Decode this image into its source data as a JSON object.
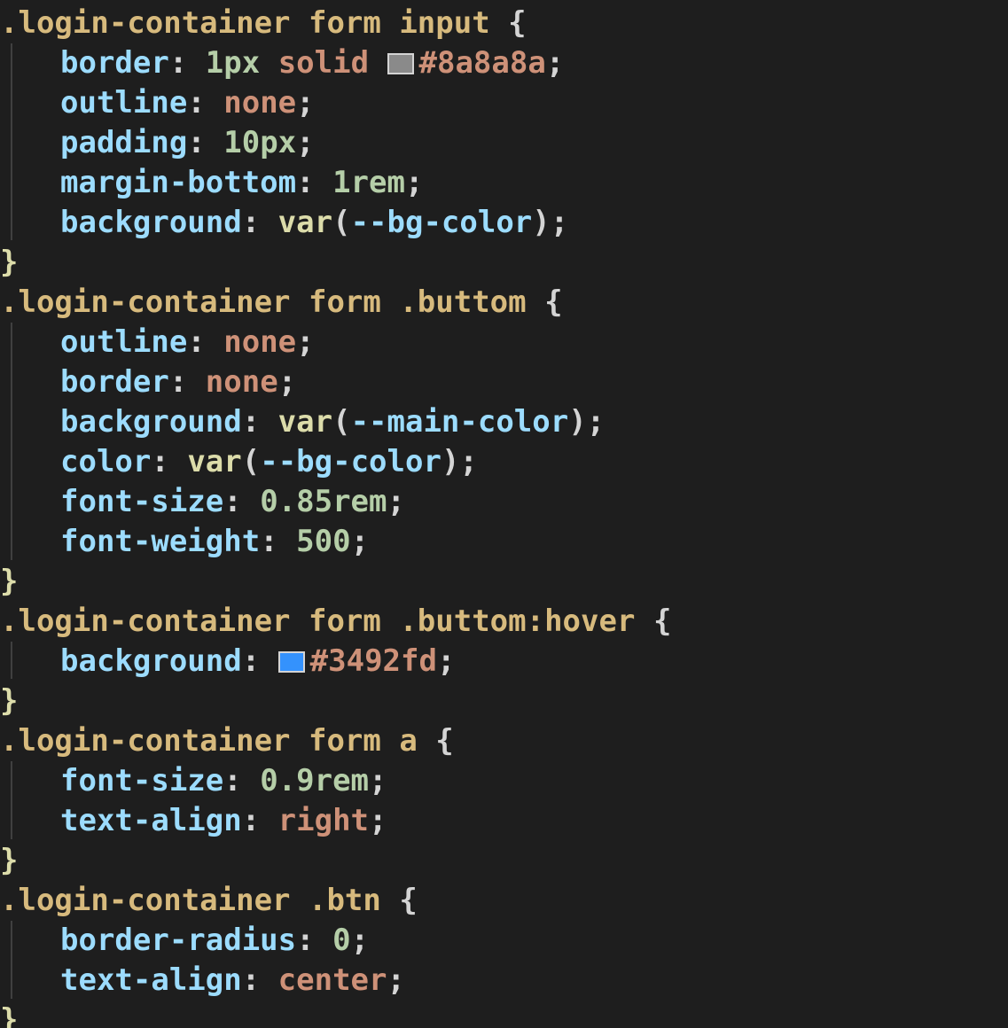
{
  "editor": {
    "blocks": [
      {
        "selector": ".login-container form input",
        "lines": [
          {
            "prop": "border",
            "value_parts": [
              "1px",
              " solid "
            ],
            "swatch": "#8a8a8a",
            "color_text": "#8a8a8a"
          },
          {
            "prop": "outline",
            "value": "none"
          },
          {
            "prop": "padding",
            "value": "10px"
          },
          {
            "prop": "margin-bottom",
            "value": "1rem"
          },
          {
            "prop": "background",
            "func": "var",
            "arg": "--bg-color"
          }
        ]
      },
      {
        "selector": ".login-container form .buttom",
        "lines": [
          {
            "prop": "outline",
            "value": "none"
          },
          {
            "prop": "border",
            "value": "none"
          },
          {
            "prop": "background",
            "func": "var",
            "arg": "--main-color"
          },
          {
            "prop": "color",
            "func": "var",
            "arg": "--bg-color"
          },
          {
            "prop": "font-size",
            "value": "0.85rem"
          },
          {
            "prop": "font-weight",
            "value": "500"
          }
        ]
      },
      {
        "selector": ".login-container form .buttom:hover",
        "lines": [
          {
            "prop": "background",
            "swatch": "#3492fd",
            "color_text": "#3492fd"
          }
        ]
      },
      {
        "selector": ".login-container form a",
        "lines": [
          {
            "prop": "font-size",
            "value": "0.9rem"
          },
          {
            "prop": "text-align",
            "value": "right"
          }
        ]
      },
      {
        "selector": ".login-container .btn",
        "lines": [
          {
            "prop": "border-radius",
            "value": "0"
          },
          {
            "prop": "text-align",
            "value": "center"
          }
        ]
      }
    ],
    "open_brace": "{",
    "close_brace": "}",
    "colon": ":",
    "semicolon": ";"
  }
}
